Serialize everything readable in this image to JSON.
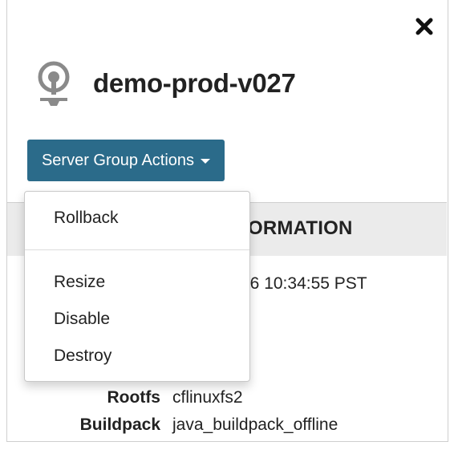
{
  "panel": {
    "title": "demo-prod-v027",
    "close_icon": "close-icon",
    "title_icon": "server-group-icon"
  },
  "actions": {
    "button_label": "Server Group Actions",
    "menu": [
      {
        "label": "Rollback"
      },
      {
        "label": "Resize"
      },
      {
        "label": "Disable"
      },
      {
        "label": "Destroy"
      }
    ]
  },
  "info": {
    "section_title_visible": "ORMATION",
    "created_visible": "16 10:34:55 PST",
    "rows": [
      {
        "key": "Rootfs",
        "value": "cflinuxfs2"
      },
      {
        "key": "Buildpack",
        "value": "java_buildpack_offline"
      }
    ]
  },
  "colors": {
    "button_bg": "#2b6b8a",
    "section_bg": "#ebebeb",
    "icon_gray": "#8a8a8a"
  }
}
